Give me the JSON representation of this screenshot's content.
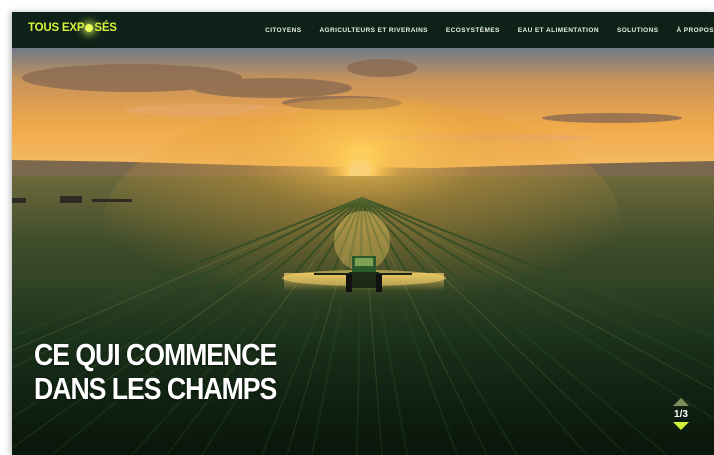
{
  "header": {
    "logo_part1": "TOUS EXP",
    "logo_part2": "SÉS",
    "nav": [
      {
        "label": "CITOYENS"
      },
      {
        "label": "AGRICULTEURS ET RIVERAINS"
      },
      {
        "label": "ECOSYSTÈMES"
      },
      {
        "label": "EAU ET ALIMENTATION"
      },
      {
        "label": "SOLUTIONS"
      },
      {
        "label": "À PROPOS"
      }
    ]
  },
  "hero": {
    "headline_line1": "CE QUI COMMENCE",
    "headline_line2": "DANS LES CHAMPS",
    "image_icon": "tractor-spraying-field-sunset-image"
  },
  "pager": {
    "current_total": "1/3",
    "up_icon": "triangle-up-icon",
    "down_icon": "triangle-down-icon"
  },
  "colors": {
    "brand": "#d7f23a",
    "nav_background": "#0e2118",
    "text": "#ffffff"
  }
}
